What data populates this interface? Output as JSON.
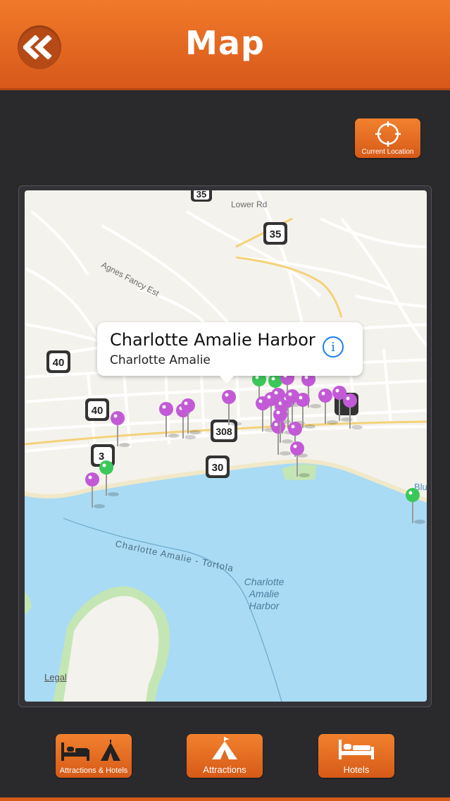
{
  "header": {
    "title": "Map",
    "back_icon": "double-chevron-left-icon"
  },
  "current_location": {
    "label": "Current Location",
    "icon": "crosshair-icon"
  },
  "map": {
    "callout": {
      "title": "Charlotte Amalie Harbor",
      "subtitle": "Charlotte Amalie",
      "info_icon": "info-icon"
    },
    "legal": "Legal",
    "labels": {
      "lower_rd": "Lower Rd",
      "agnes_fancy": "Agnes Fancy Est",
      "route_to_tortola": "Charlotte Amalie - Tortola",
      "harbor_1": "Charlotte",
      "harbor_2": "Amalie",
      "harbor_3": "Harbor",
      "blu": "Blu"
    },
    "shields": [
      "35",
      "35",
      "40",
      "40",
      "308",
      "30",
      "3"
    ],
    "pin_colors": {
      "attraction": "#c25ad6",
      "hotel": "#3bc85a"
    }
  },
  "tabs": [
    {
      "label": "Attractions & Hotels",
      "icon": "bed-and-tent-icon"
    },
    {
      "label": "Attractions",
      "icon": "tent-icon"
    },
    {
      "label": "Hotels",
      "icon": "bed-icon"
    }
  ],
  "colors": {
    "accent": "#e86a24",
    "background": "#2a2a2d",
    "water": "#a9dbf4",
    "land": "#f4f2ec",
    "park": "#c4e6b4"
  }
}
